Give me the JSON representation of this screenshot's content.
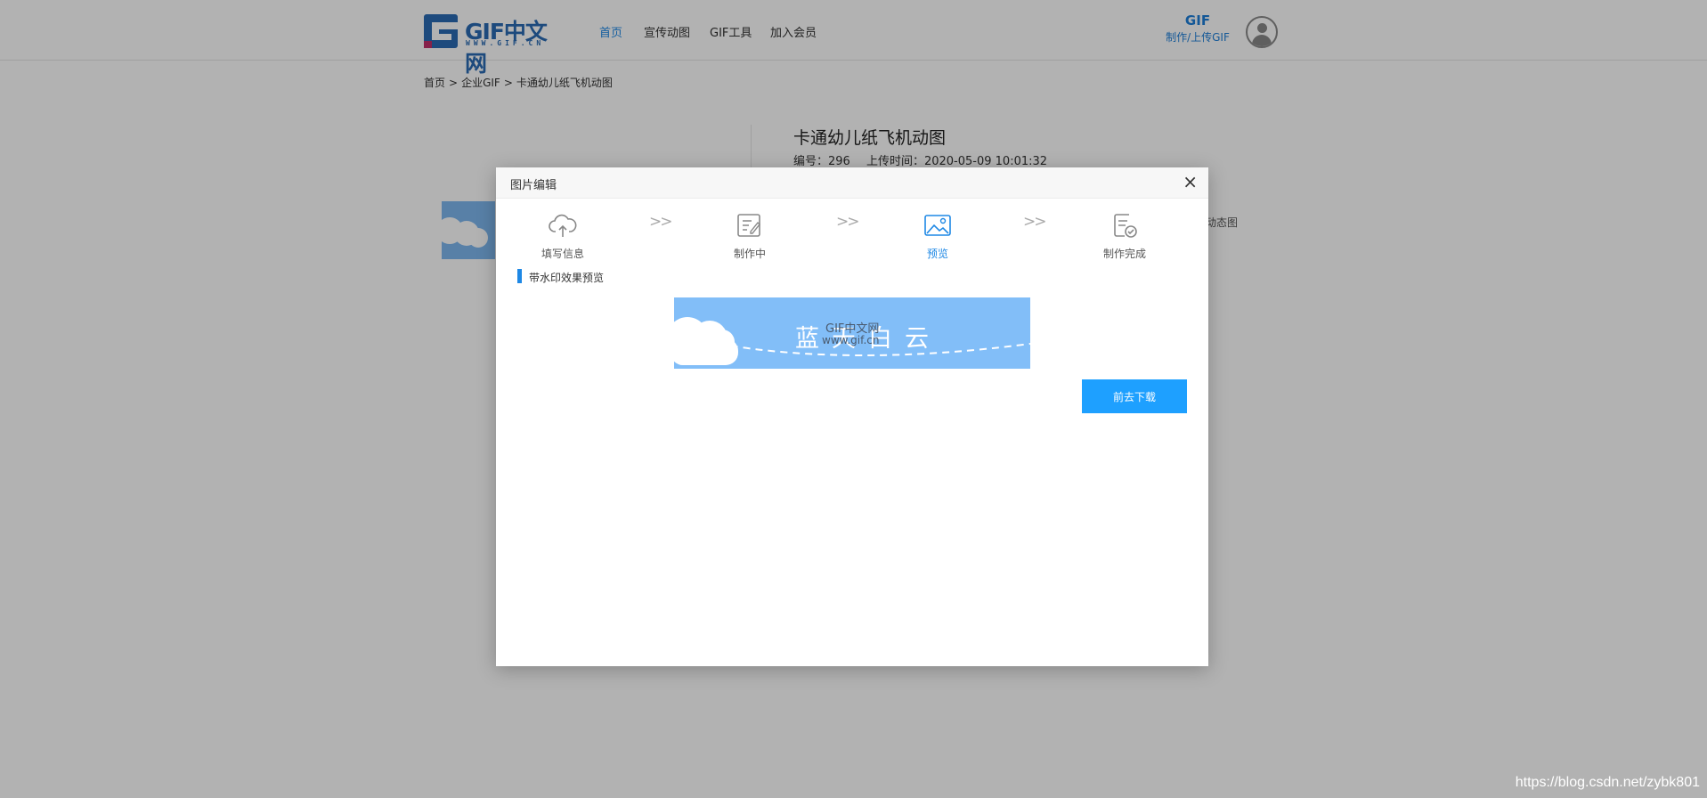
{
  "header": {
    "logo_text": "GIF中文网",
    "logo_sub": "WWW.GIF.CN",
    "nav": [
      {
        "label": "首页",
        "active": true
      },
      {
        "label": "宣传动图",
        "active": false
      },
      {
        "label": "GIF工具",
        "active": false
      },
      {
        "label": "加入会员",
        "active": false
      }
    ],
    "gif_button": {
      "title": "GIF",
      "subtitle": "制作/上传GIF"
    }
  },
  "breadcrumb": [
    "首页",
    ">",
    "企业GIF",
    ">",
    "卡通幼儿纸飞机动图"
  ],
  "detail": {
    "title": "卡通幼儿纸飞机动图",
    "id_label": "编号：296",
    "upload_label": "上传时间：2020-05-09 10:01:32",
    "tag_fragment": "动态图"
  },
  "modal": {
    "title": "图片编辑",
    "close": "×",
    "steps": [
      {
        "label": "填写信息",
        "icon": "cloud-upload-icon",
        "active": false
      },
      {
        "label": "制作中",
        "icon": "edit-document-icon",
        "active": false
      },
      {
        "label": "预览",
        "icon": "image-preview-icon",
        "active": true
      },
      {
        "label": "制作完成",
        "icon": "document-check-icon",
        "active": false
      }
    ],
    "step_arrow": ">>",
    "section_title": "带水印效果预览",
    "preview": {
      "text": "蓝天白云",
      "watermark_line1": "GIF中文网",
      "watermark_line2": "www.gif.cn"
    },
    "download_button": "前去下载"
  },
  "watermark": "https://blog.csdn.net/zybk801",
  "colors": {
    "accent": "#1e88e5",
    "button": "#1ea0ff",
    "preview_bg": "#82bef8"
  }
}
